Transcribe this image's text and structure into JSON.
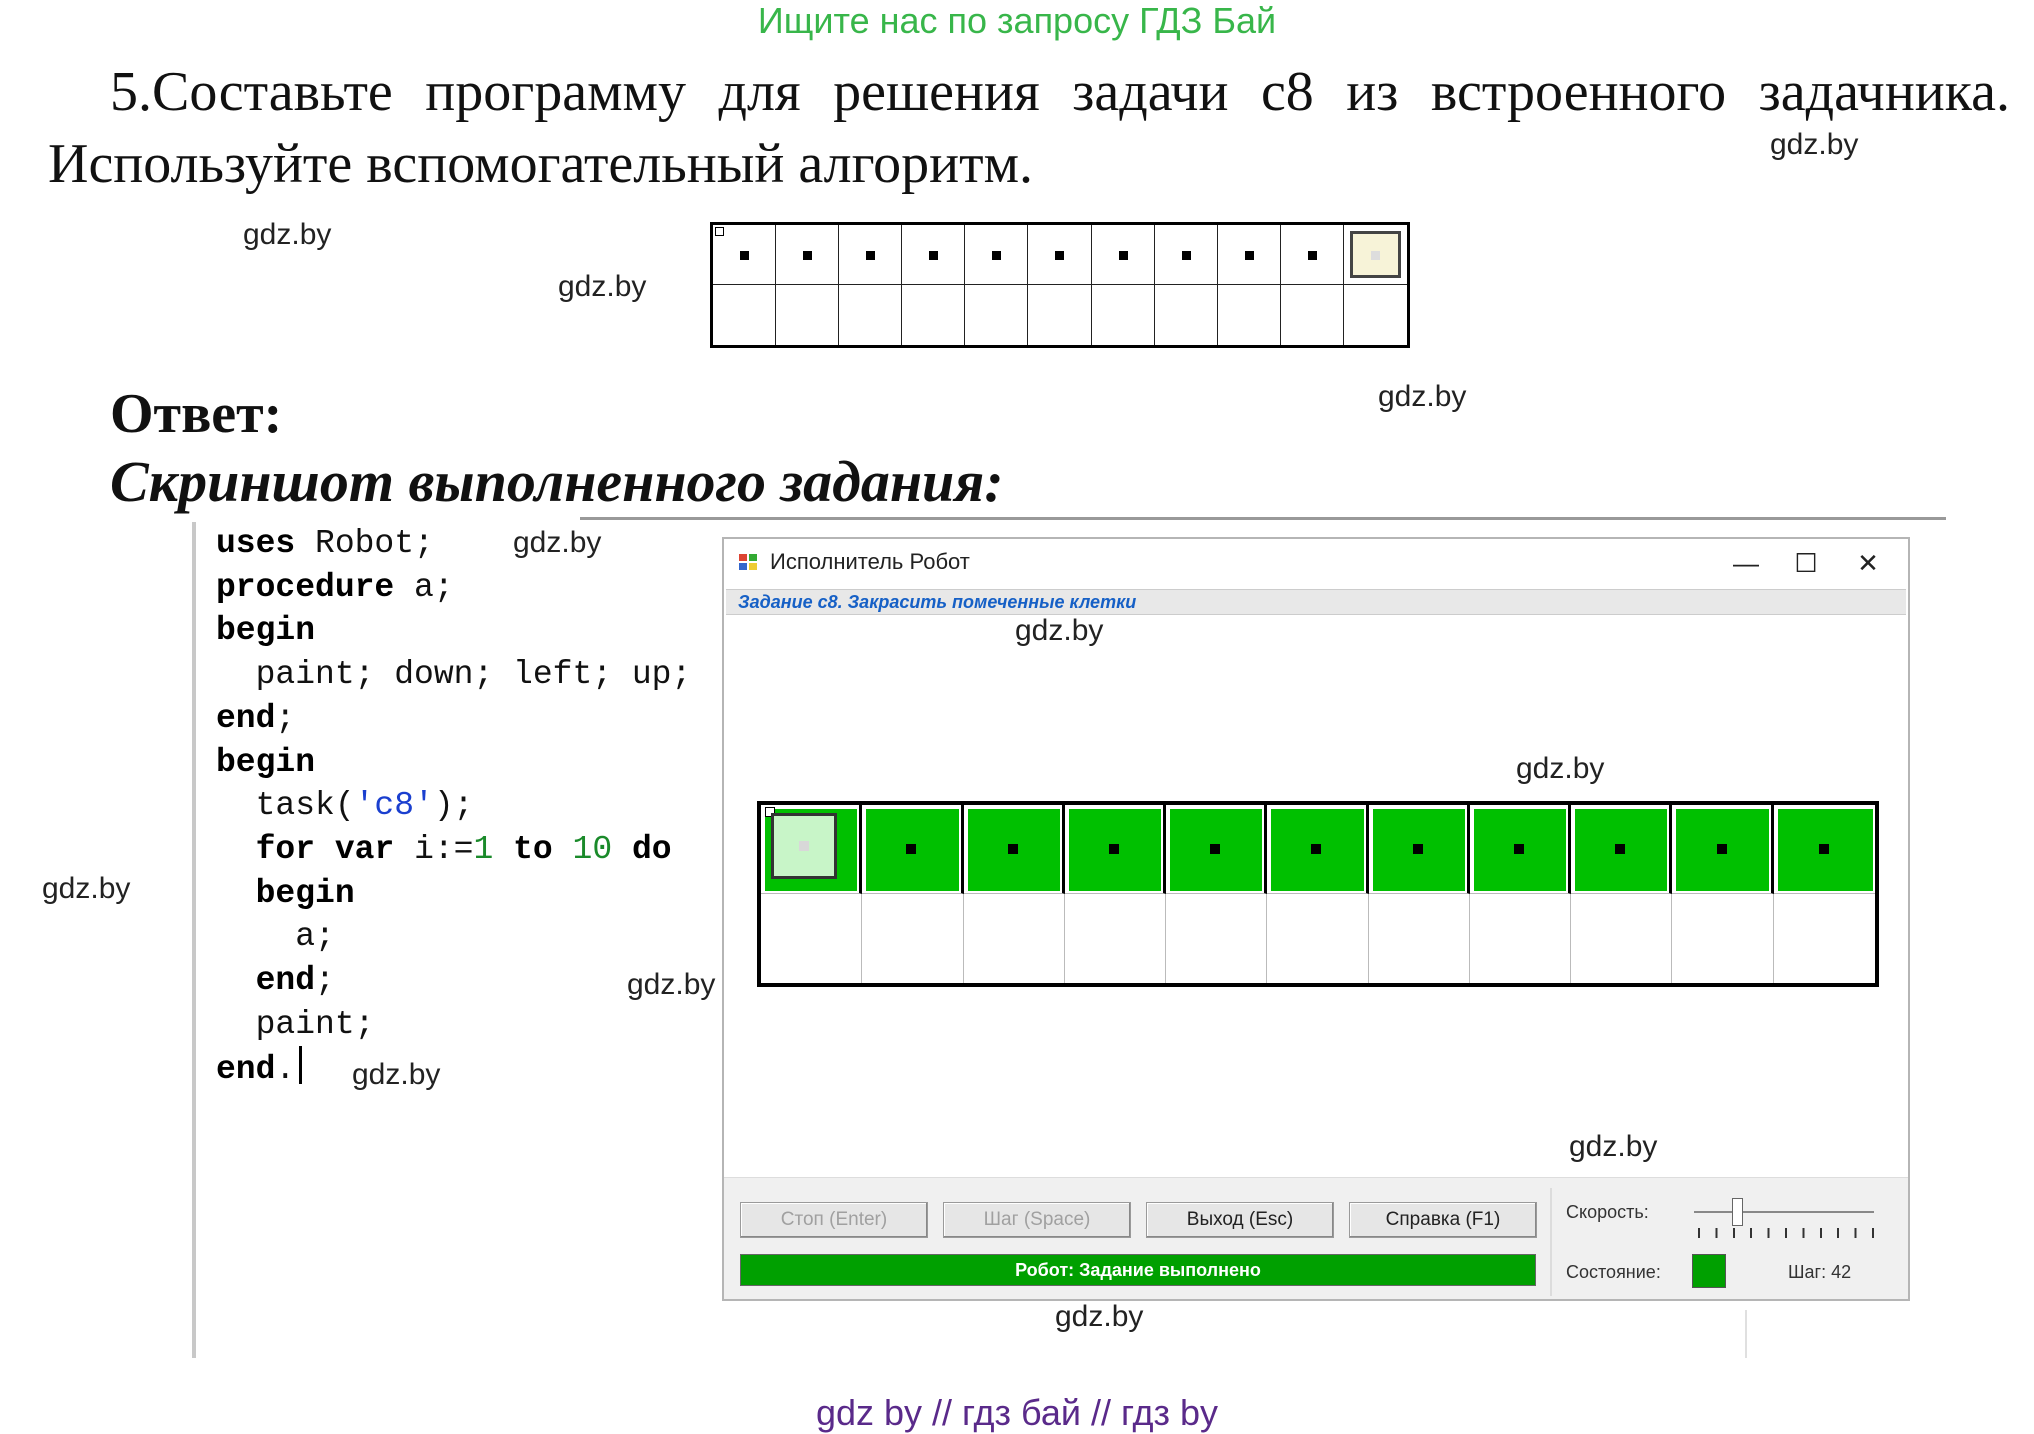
{
  "top_banner": "Ищите нас по запросу ГДЗ Бай",
  "task": {
    "line1": "5.Составьте программу для решения задачи c8 из встроенного задачника.",
    "line2": "Используйте вспомогательный алгоритм."
  },
  "answer_label": "Ответ:",
  "screenshot_label": "Скриншот выполненного задания:",
  "watermark": "gdz.by",
  "code": {
    "lines": [
      "uses Robot;",
      "procedure a;",
      "begin",
      "  paint; down; left; up;",
      "end;",
      "begin",
      "  task('c8');",
      "  for var i:=1 to 10 do",
      "  begin",
      "    a;",
      "  end;",
      "  paint;",
      "end."
    ]
  },
  "robot_window": {
    "title": "Исполнитель Робот",
    "controls": {
      "minimize": "—",
      "maximize": "☐",
      "close": "✕"
    },
    "task_header": "Задание c8. Закрасить помеченные клетки",
    "field": {
      "columns": 11,
      "rows": 2,
      "painted_cells_top_row": 11,
      "marked_cells": 11
    },
    "buttons": {
      "stop": "Стоп (Enter)",
      "step": "Шаг (Space)",
      "exit": "Выход (Esc)",
      "help": "Справка (F1)"
    },
    "status_text": "Робот: Задание выполнено",
    "speed_label": "Скорость:",
    "state_label": "Состояние:",
    "step_count": "Шаг: 42",
    "colors": {
      "painted": "#00c000",
      "status": "#00a000",
      "header_text": "#1660c6"
    }
  },
  "bottom_banner": "gdz by  //  гдз бай  //  гдз by"
}
